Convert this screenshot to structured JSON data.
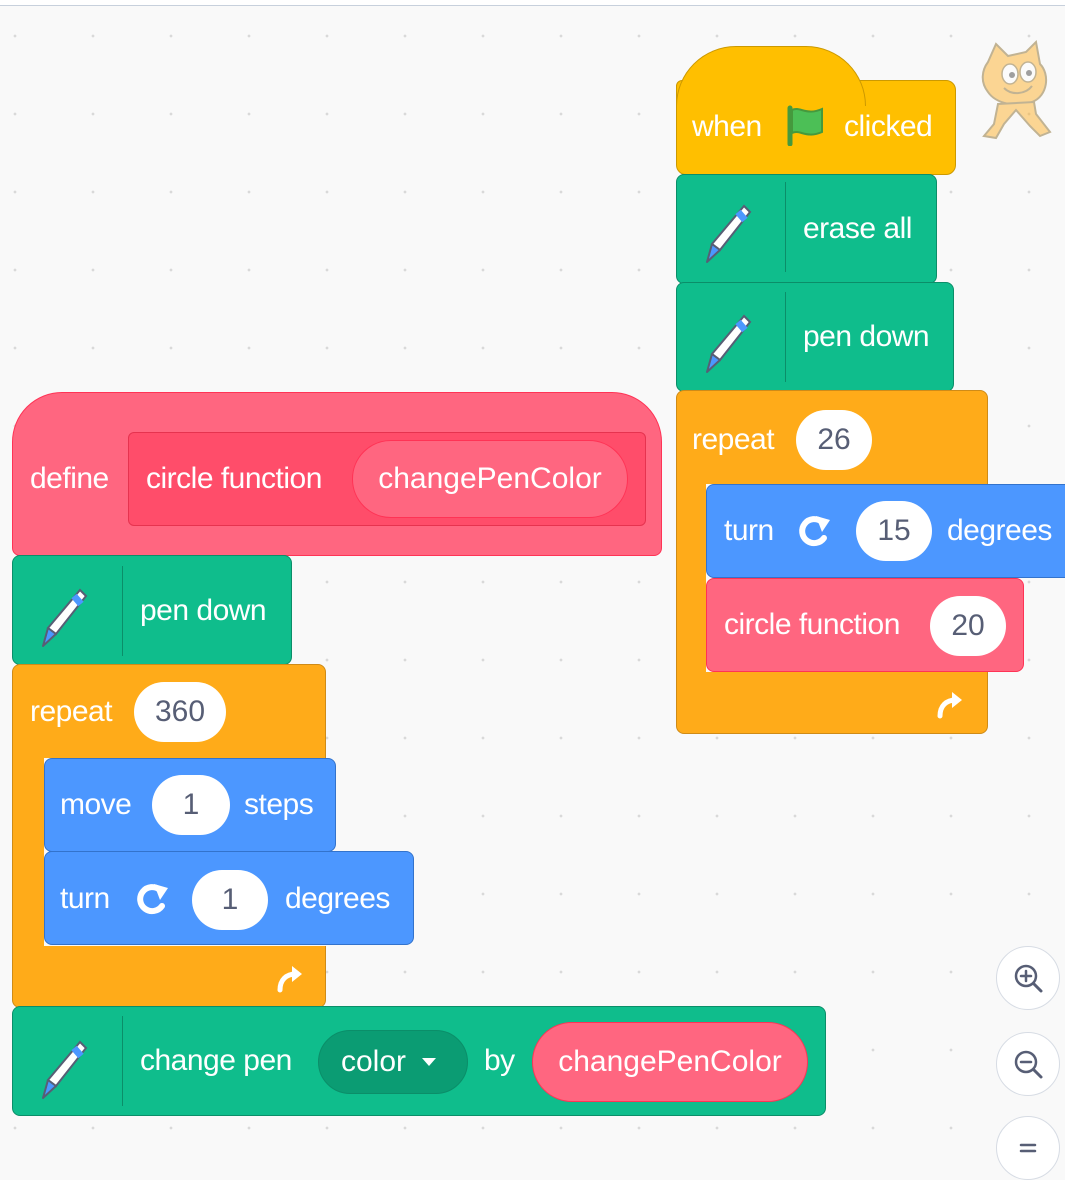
{
  "script_right": {
    "hat": {
      "when": "when",
      "clicked": "clicked"
    },
    "erase_all": "erase all",
    "pen_down": "pen down",
    "repeat": {
      "label": "repeat",
      "count": "26"
    },
    "turn": {
      "label": "turn",
      "value": "15",
      "unit": "degrees"
    },
    "call": {
      "label": "circle function",
      "value": "20"
    }
  },
  "script_left": {
    "define": {
      "label": "define",
      "name": "circle function",
      "param": "changePenColor"
    },
    "pen_down": "pen down",
    "repeat": {
      "label": "repeat",
      "count": "360"
    },
    "move": {
      "label": "move",
      "value": "1",
      "unit": "steps"
    },
    "turn": {
      "label": "turn",
      "value": "1",
      "unit": "degrees"
    },
    "change_pen": {
      "label": "change pen",
      "dropdown": "color",
      "by": "by",
      "reporter": "changePenColor"
    }
  },
  "zoom": {
    "in_icon": "zoom-in-icon",
    "out_icon": "zoom-out-icon",
    "reset_icon": "zoom-reset-icon"
  },
  "colors": {
    "events": "#ffbf00",
    "pen": "#0fbd8c",
    "control": "#ffab19",
    "motion": "#4c97ff",
    "custom": "#ff6680"
  }
}
